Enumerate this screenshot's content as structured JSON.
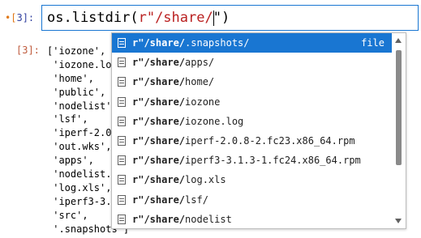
{
  "input_cell": {
    "prompt_prefix": "•[",
    "prompt_num": "3",
    "prompt_suffix": "]:",
    "code_prefix": "os.listdir(",
    "code_string": "r\"/share/",
    "code_suffix": "\")"
  },
  "output_cell": {
    "prompt": "[3]:",
    "lines": [
      "['iozone',",
      " 'iozone.lo",
      " 'home',",
      " 'public',",
      " 'nodelist'",
      " 'lsf',",
      " 'iperf-2.0",
      " 'out.wks',",
      " 'apps',",
      " 'nodelist.",
      " 'log.xls',",
      " 'iperf3-3.",
      " 'src',",
      " '.snapshots']"
    ]
  },
  "completer": {
    "items": [
      {
        "prefix": "r\"/share/",
        "rest": ".snapshots/",
        "type": "file",
        "active": true
      },
      {
        "prefix": "r\"/share/",
        "rest": "apps/",
        "type": "",
        "active": false
      },
      {
        "prefix": "r\"/share/",
        "rest": "home/",
        "type": "",
        "active": false
      },
      {
        "prefix": "r\"/share/",
        "rest": "iozone",
        "type": "",
        "active": false
      },
      {
        "prefix": "r\"/share/",
        "rest": "iozone.log",
        "type": "",
        "active": false
      },
      {
        "prefix": "r\"/share/",
        "rest": "iperf-2.0.8-2.fc23.x86_64.rpm",
        "type": "",
        "active": false
      },
      {
        "prefix": "r\"/share/",
        "rest": "iperf3-3.1.3-1.fc24.x86_64.rpm",
        "type": "",
        "active": false
      },
      {
        "prefix": "r\"/share/",
        "rest": "log.xls",
        "type": "",
        "active": false
      },
      {
        "prefix": "r\"/share/",
        "rest": "lsf/",
        "type": "",
        "active": false
      },
      {
        "prefix": "r\"/share/",
        "rest": "nodelist",
        "type": "",
        "active": false
      }
    ]
  },
  "colors": {
    "accent": "#1976d2",
    "prompt_in": "#303f9f",
    "prompt_out": "#bf5b3d",
    "string": "#ba2121"
  }
}
